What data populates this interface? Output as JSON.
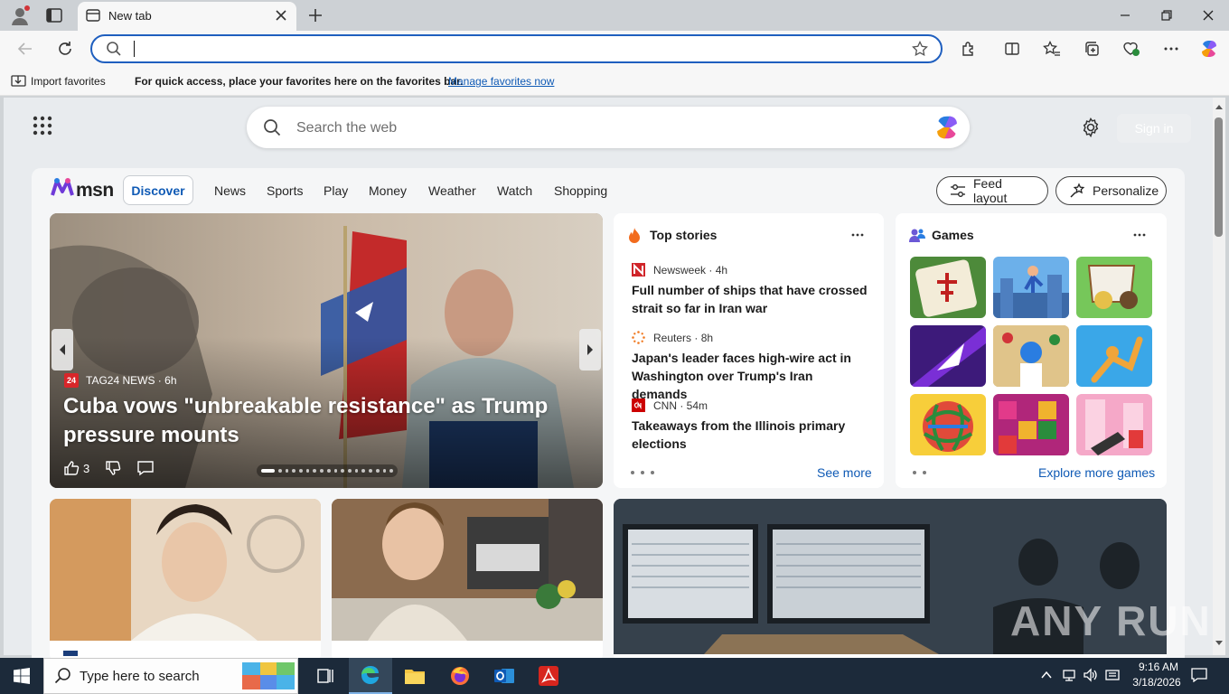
{
  "browser": {
    "tab_title": "New tab",
    "address_placeholder": "",
    "favorites_bar": {
      "import_label": "Import favorites",
      "message": "For quick access, place your favorites here on the favorites bar.",
      "manage_link": "Manage favorites now"
    }
  },
  "newtab": {
    "search_placeholder": "Search the web",
    "signin_label": "Sign in"
  },
  "msn": {
    "logo_text": "msn",
    "nav": [
      "Discover",
      "News",
      "Sports",
      "Play",
      "Money",
      "Weather",
      "Watch",
      "Shopping"
    ],
    "active_nav": "Discover",
    "feed_layout_label": "Feed layout",
    "personalize_label": "Personalize",
    "hero": {
      "source": "TAG24 NEWS",
      "source_badge": "24",
      "age": "6h",
      "title": "Cuba vows \"unbreakable resistance\" as Trump pressure mounts",
      "likes": "3",
      "slides_total": 18,
      "slide_active": 1
    },
    "top_stories": {
      "title": "Top stories",
      "stories": [
        {
          "source": "Newsweek",
          "age": "4h",
          "title": "Full number of ships that have crossed strait so far in Iran war"
        },
        {
          "source": "Reuters",
          "age": "8h",
          "title": "Japan's leader faces high-wire act in Washington over Trump's Iran demands"
        },
        {
          "source": "CNN",
          "age": "54m",
          "title": "Takeaways from the Illinois primary elections"
        }
      ],
      "see_more": "See more"
    },
    "games": {
      "title": "Games",
      "explore": "Explore more games"
    },
    "watermark": "ANY RUN"
  },
  "taskbar": {
    "search_placeholder": "Type here to search",
    "time": "9:16 AM",
    "date": "3/18/2026"
  },
  "colors": {
    "accent": "#0f5ab5",
    "address_border": "#1f5fbf",
    "taskbar": "#1c2a3a"
  }
}
